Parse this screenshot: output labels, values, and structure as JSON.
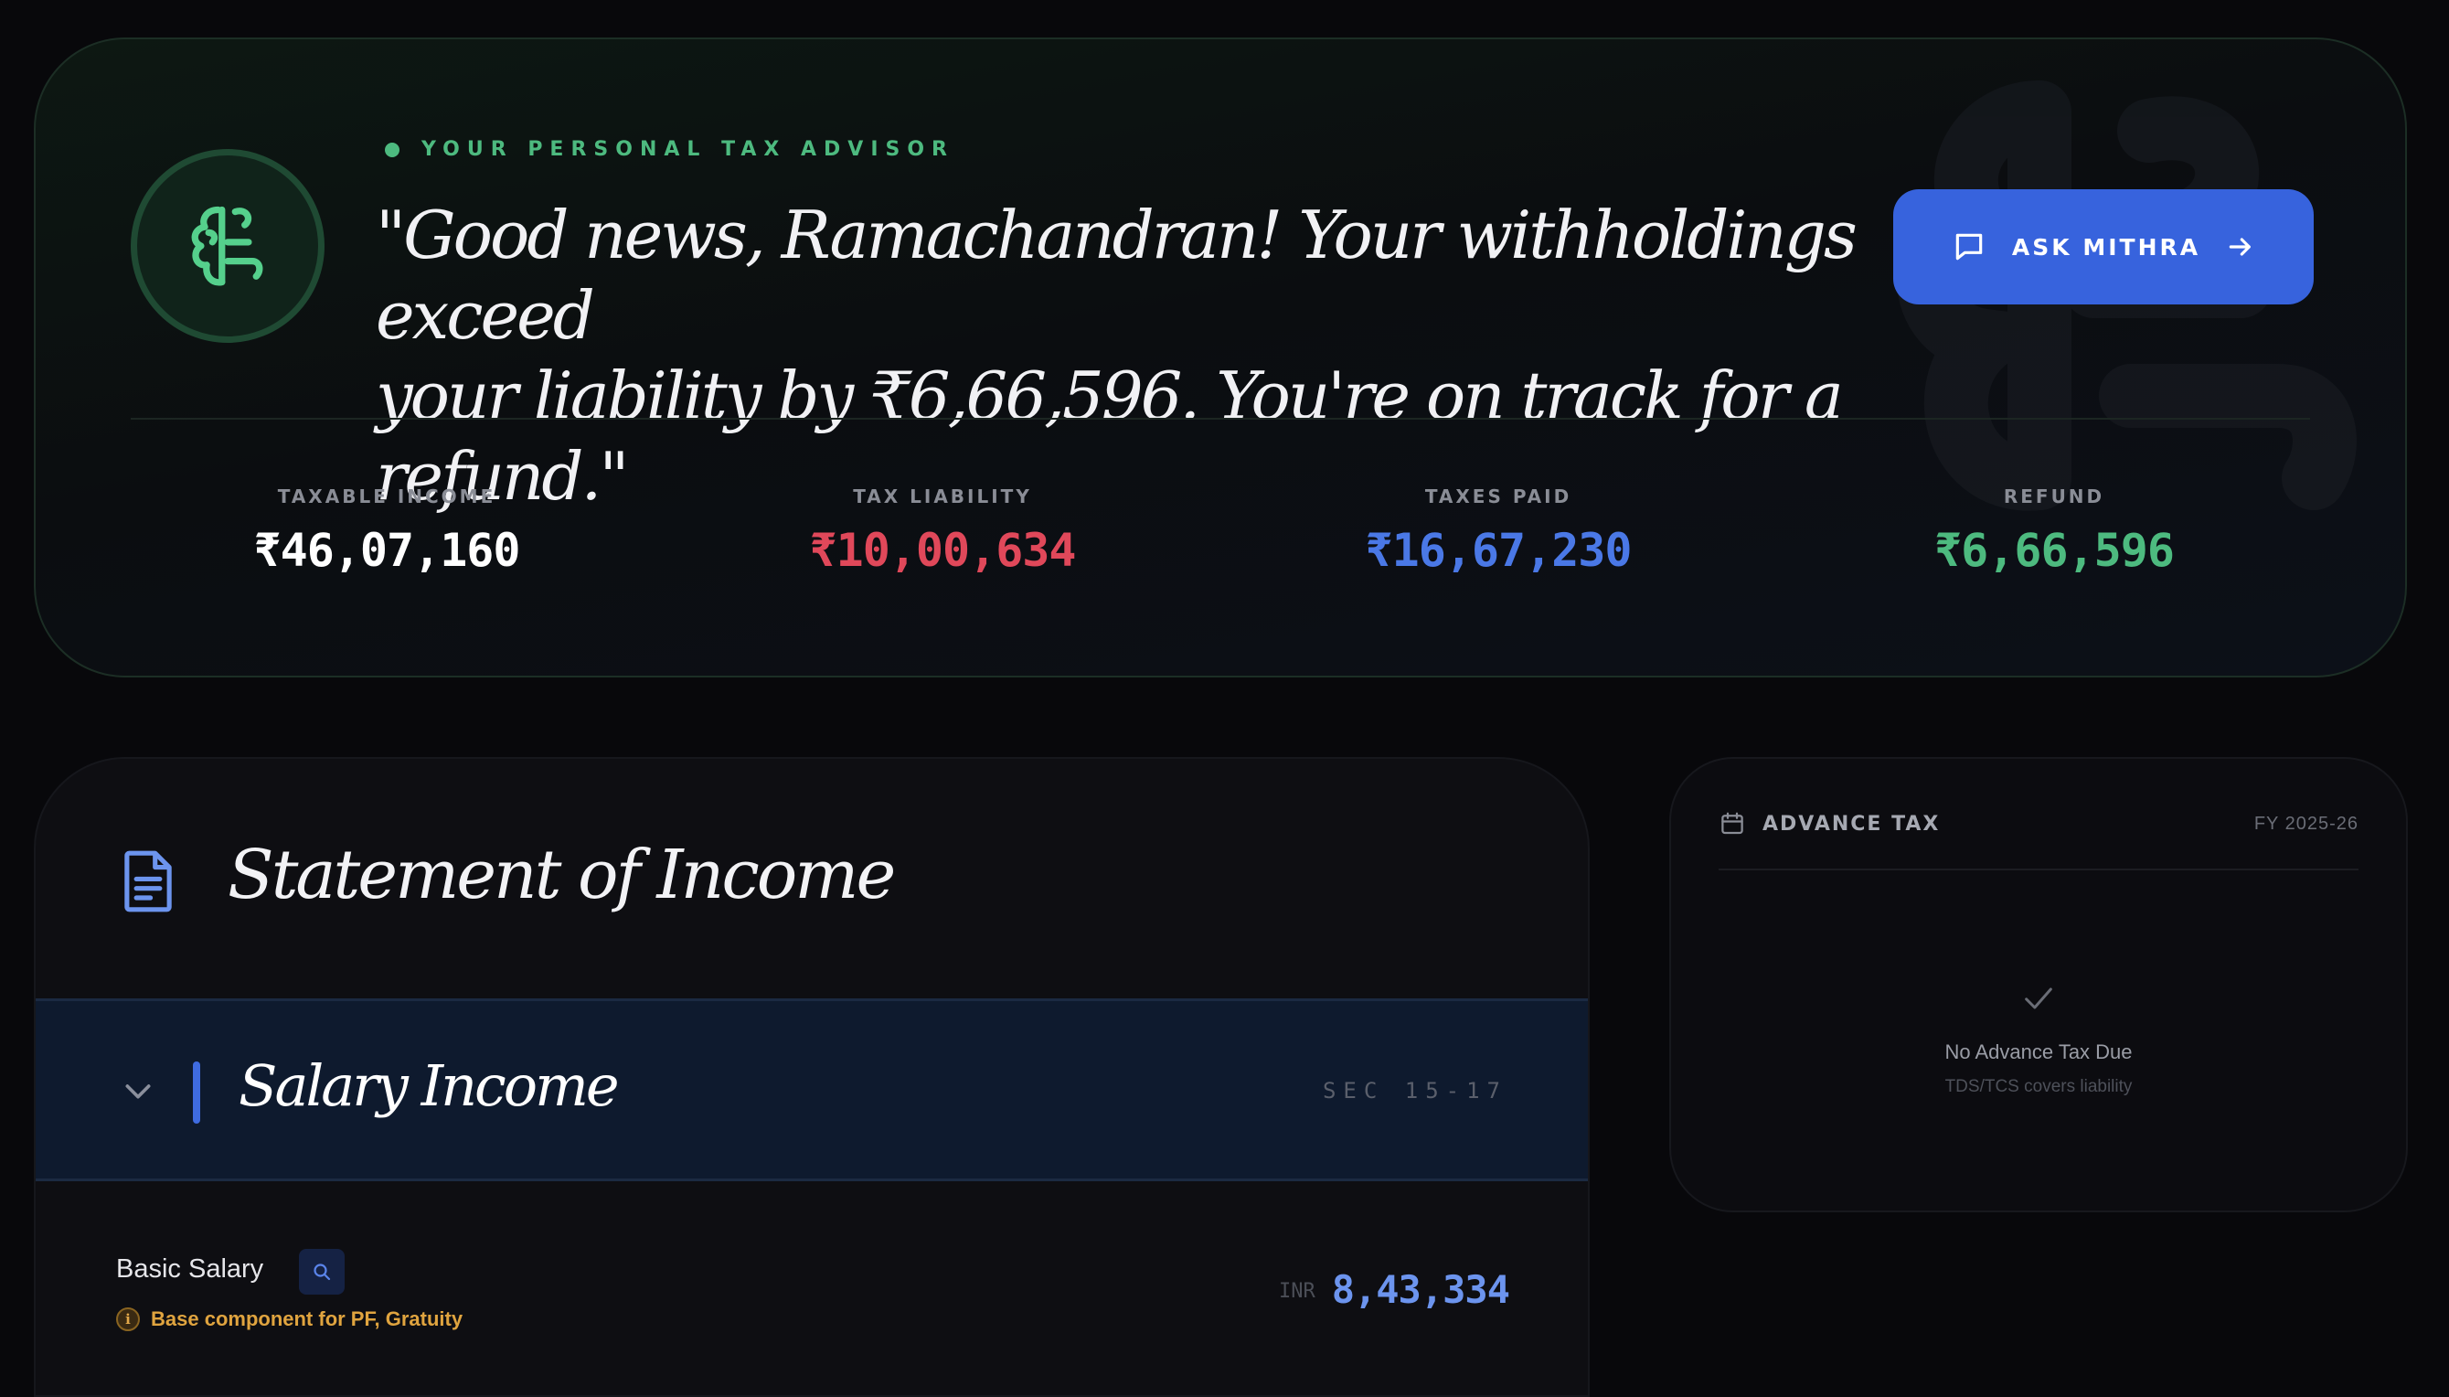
{
  "hero": {
    "eyebrow": "YOUR PERSONAL TAX ADVISOR",
    "quote_line1": "\"Good news, Ramachandran! Your withholdings exceed",
    "quote_line2": "your liability by ₹6,66,596. You're on track for a refund.\"",
    "ask_button": "ASK MITHRA",
    "icons": {
      "avatar": "brain-icon",
      "button": "chat-bubble-icon",
      "button_trailing": "arrow-right-icon"
    },
    "colors": {
      "accent_green": "#4dba7f",
      "button_blue": "#3763dd"
    }
  },
  "stats": [
    {
      "label": "TAXABLE INCOME",
      "value": "₹46,07,160",
      "color": "#ffffff"
    },
    {
      "label": "TAX LIABILITY",
      "value": "₹10,00,634",
      "color": "#e0485a"
    },
    {
      "label": "TAXES PAID",
      "value": "₹16,67,230",
      "color": "#4a78e6"
    },
    {
      "label": "REFUND",
      "value": "₹6,66,596",
      "color": "#4dba7f"
    }
  ],
  "income": {
    "title": "Statement of Income",
    "section": {
      "title": "Salary Income",
      "tag": "SEC 15-17",
      "expanded": true
    },
    "items": [
      {
        "name": "Basic Salary",
        "note": "Base component for PF, Gratuity",
        "currency": "INR",
        "value": "8,43,334"
      }
    ]
  },
  "advance_tax": {
    "title": "ADVANCE TAX",
    "fy": "FY 2025-26",
    "message": "No Advance Tax Due",
    "sub": "TDS/TCS covers liability"
  }
}
